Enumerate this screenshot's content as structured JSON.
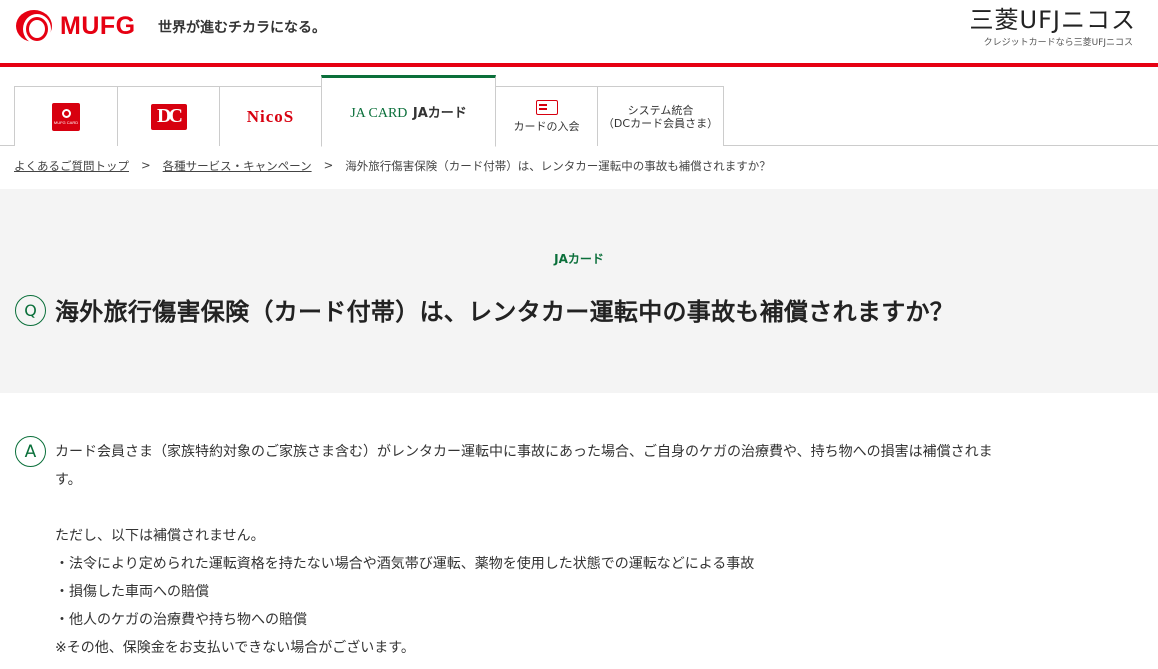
{
  "header": {
    "logo_text": "MUFG",
    "tagline": "世界が進むチカラになる。",
    "brand_name": "三菱UFJニコス",
    "brand_sub": "クレジットカードなら三菱UFJニコス",
    "accent_color": "#e60012"
  },
  "tabs": {
    "mufg_card_mini": "MUFG CARD",
    "dc_mark": "DC",
    "nicos": "NicoS",
    "ja_card_en": "JA CARD",
    "ja_card_jp": "JAカード",
    "join": "カードの入会",
    "system_line1": "システム統合",
    "system_line2": "（DCカード会員さま）"
  },
  "breadcrumb": {
    "items": [
      "よくあるご質問トップ",
      "各種サービス・キャンペーン",
      "海外旅行傷害保険（カード付帯）は、レンタカー運転中の事故も補償されますか？"
    ],
    "separator": ">"
  },
  "question": {
    "category": "JAカード",
    "q_mark": "Q",
    "title": "海外旅行傷害保険（カード付帯）は、レンタカー運転中の事故も補償されますか？",
    "accent_color": "#0a6f3a"
  },
  "answer": {
    "a_mark": "A",
    "line1": "カード会員さま（家族特約対象のご家族さま含む）がレンタカー運転中に事故にあった場合、ご自身のケガの治療費や、持ち物への損害は補償されま",
    "line1_cont": "す。",
    "line2": "ただし、以下は補償されません。",
    "line3": "・法令により定められた運転資格を持たない場合や酒気帯び運転、薬物を使用した状態での運転などによる事故",
    "line4": "・損傷した車両への賠償",
    "line5": "・他人のケガの治療費や持ち物への賠償",
    "line6": "※その他、保険金をお支払いできない場合がございます。"
  }
}
